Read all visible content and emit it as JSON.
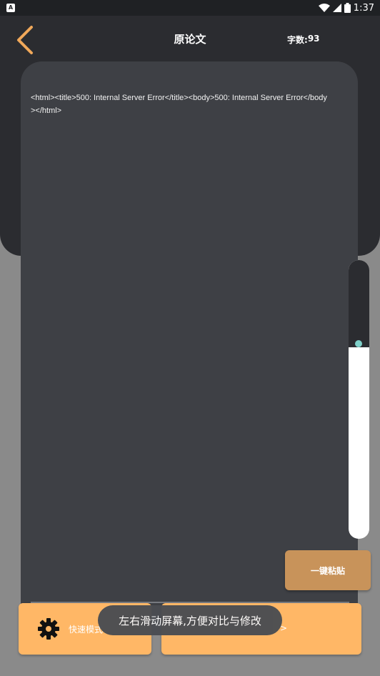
{
  "status_bar": {
    "time": "1:37",
    "app_icon_letter": "A"
  },
  "header": {
    "title": "原论文",
    "word_count_label": "字数:",
    "word_count_value": "93"
  },
  "editor": {
    "content": "<html><title>500: Internal Server Error</title><body>500: Internal Server Error</body></html>"
  },
  "scroll_slider": {
    "position": 0.31
  },
  "actions": {
    "paste_label": "一键粘贴",
    "quick_mode_label": "快速模式",
    "next_label": ">"
  },
  "toast": {
    "text": "左右滑动屏幕,方便对比与修改"
  },
  "colors": {
    "accent": "#ffb766",
    "paste": "#c8935a",
    "panel": "#3e4045",
    "header": "#2b2c30",
    "back_arrow": "#f0a85a",
    "slider_knob": "#7fd0c9"
  },
  "icons": [
    "back-arrow-icon",
    "wifi-icon",
    "signal-icon",
    "battery-icon",
    "gear-icon"
  ]
}
